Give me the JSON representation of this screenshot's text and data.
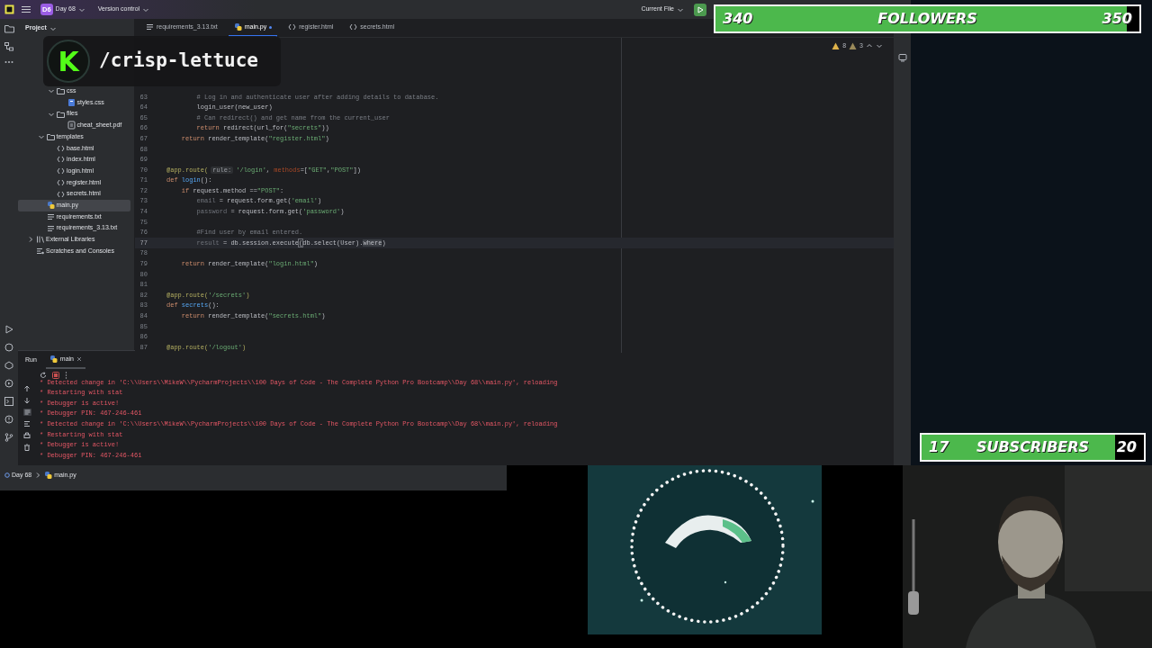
{
  "title_bar": {
    "project_initials": "D6",
    "project": "Day 68",
    "vcs": "Version control",
    "run_config": "Current File"
  },
  "project_panel": {
    "title": "Project",
    "tree": [
      {
        "children": [
          {
            "children": [
              {
                "label": "css",
                "kind": "folder",
                "expanded": true,
                "selected": false,
                "children": [
                  {
                    "label": "styles.css",
                    "kind": "css",
                    "selected": false
                  }
                ]
              },
              {
                "label": "files",
                "kind": "folder",
                "expanded": true,
                "selected": false,
                "children": [
                  {
                    "label": "cheat_sheet.pdf",
                    "kind": "pdf",
                    "selected": false
                  }
                ]
              }
            ]
          },
          {
            "label": "templates",
            "kind": "folder",
            "expanded": true,
            "selected": false,
            "children": [
              {
                "label": "base.html",
                "kind": "html",
                "selected": false
              },
              {
                "label": "index.html",
                "kind": "html",
                "selected": false
              },
              {
                "label": "login.html",
                "kind": "html",
                "selected": false
              },
              {
                "label": "register.html",
                "kind": "html",
                "selected": false
              },
              {
                "label": "secrets.html",
                "kind": "html",
                "selected": false
              }
            ]
          },
          {
            "label": "main.py",
            "kind": "python",
            "selected": true
          },
          {
            "label": "requirements.txt",
            "kind": "text",
            "selected": false
          },
          {
            "label": "requirements_3.13.txt",
            "kind": "text",
            "selected": false
          }
        ]
      },
      {
        "label": "External Libraries",
        "kind": "library",
        "expanded": false,
        "selected": false
      },
      {
        "label": "Scratches and Consoles",
        "kind": "scratches",
        "selected": false
      }
    ]
  },
  "editor_tabs": [
    {
      "label": "requirements_3.13.txt",
      "kind": "text",
      "selected": false,
      "modified": false
    },
    {
      "label": "main.py",
      "kind": "python",
      "selected": true,
      "modified": true
    },
    {
      "label": "register.html",
      "kind": "html",
      "selected": false,
      "modified": false
    },
    {
      "label": "secrets.html",
      "kind": "html",
      "selected": false,
      "modified": false
    }
  ],
  "inspections": {
    "warnings": "8",
    "weak_warnings": "3"
  },
  "editor": {
    "lines": [
      {
        "number": "63",
        "current": false,
        "segments": [
          {
            "text": "        # Log in and authenticate user after adding details to database.",
            "kind": "comment"
          }
        ]
      },
      {
        "number": "64",
        "current": false,
        "segments": [
          {
            "text": "        login_user(new_user)",
            "kind": "plain"
          }
        ]
      },
      {
        "number": "65",
        "current": false,
        "segments": [
          {
            "text": "        # Can redirect() and get name from the current_user",
            "kind": "comment"
          }
        ]
      },
      {
        "number": "66",
        "current": false,
        "segments": [
          {
            "text": "        return",
            "kind": "keyword"
          },
          {
            "text": " redirect(url_for(",
            "kind": "plain"
          },
          {
            "text": "\"secrets\"",
            "kind": "string"
          },
          {
            "text": "))",
            "kind": "plain"
          }
        ]
      },
      {
        "number": "67",
        "current": false,
        "segments": [
          {
            "text": "    return",
            "kind": "keyword"
          },
          {
            "text": " render_template(",
            "kind": "plain"
          },
          {
            "text": "\"register.html\"",
            "kind": "string"
          },
          {
            "text": ")",
            "kind": "plain"
          }
        ]
      },
      {
        "number": "68",
        "current": false
      },
      {
        "number": "69",
        "current": false
      },
      {
        "number": "70",
        "current": false,
        "segments": [
          {
            "text": "@app.route(",
            "kind": "decorator"
          },
          {
            "text": "rule:",
            "kind": "hint"
          },
          {
            "text": "'/login'",
            "kind": "string"
          },
          {
            "text": ", ",
            "kind": "plain"
          },
          {
            "text": "methods",
            "kind": "param"
          },
          {
            "text": "=[",
            "kind": "plain"
          },
          {
            "text": "\"GET\"",
            "kind": "string"
          },
          {
            "text": ",",
            "kind": "plain"
          },
          {
            "text": "\"POST\"",
            "kind": "string"
          },
          {
            "text": "])",
            "kind": "plain"
          }
        ]
      },
      {
        "number": "71",
        "current": false,
        "segments": [
          {
            "text": "def",
            "kind": "keyword"
          },
          {
            "text": " login",
            "kind": "function"
          },
          {
            "text": "():",
            "kind": "plain"
          }
        ]
      },
      {
        "number": "72",
        "current": false,
        "segments": [
          {
            "text": "    if",
            "kind": "keyword"
          },
          {
            "text": " request.method ==",
            "kind": "plain"
          },
          {
            "text": "\"POST\"",
            "kind": "string"
          },
          {
            "text": ":",
            "kind": "plain"
          }
        ]
      },
      {
        "number": "73",
        "current": false,
        "segments": [
          {
            "text": "        email",
            "kind": "unused"
          },
          {
            "text": " = request.form.get(",
            "kind": "plain"
          },
          {
            "text": "'email'",
            "kind": "string"
          },
          {
            "text": ")",
            "kind": "plain"
          }
        ]
      },
      {
        "number": "74",
        "current": false,
        "segments": [
          {
            "text": "        password",
            "kind": "unused"
          },
          {
            "text": " = request.form.get(",
            "kind": "plain"
          },
          {
            "text": "'password'",
            "kind": "string"
          },
          {
            "text": ")",
            "kind": "plain"
          }
        ]
      },
      {
        "number": "75",
        "current": false
      },
      {
        "number": "76",
        "current": false,
        "segments": [
          {
            "text": "        #Find user by email entered.",
            "kind": "comment"
          }
        ]
      },
      {
        "number": "77",
        "current": true,
        "segments": [
          {
            "text": "        result",
            "kind": "unused"
          },
          {
            "text": " = db.session.execute",
            "kind": "plain"
          },
          {
            "text": "(",
            "kind": "bracket"
          },
          {
            "text": "db.select(User).",
            "kind": "plain"
          },
          {
            "text": "where",
            "kind": "match"
          },
          {
            "text": ")",
            "kind": "plain"
          }
        ]
      },
      {
        "number": "78",
        "current": false
      },
      {
        "number": "79",
        "current": false,
        "segments": [
          {
            "text": "    return",
            "kind": "keyword"
          },
          {
            "text": " render_template(",
            "kind": "plain"
          },
          {
            "text": "\"login.html\"",
            "kind": "string"
          },
          {
            "text": ")",
            "kind": "plain"
          }
        ]
      },
      {
        "number": "80",
        "current": false
      },
      {
        "number": "81",
        "current": false
      },
      {
        "number": "82",
        "current": false,
        "segments": [
          {
            "text": "@app.route(",
            "kind": "decorator"
          },
          {
            "text": "'/secrets'",
            "kind": "string"
          },
          {
            "text": ")",
            "kind": "decorator"
          }
        ]
      },
      {
        "number": "83",
        "current": false,
        "segments": [
          {
            "text": "def",
            "kind": "keyword"
          },
          {
            "text": " secrets",
            "kind": "function"
          },
          {
            "text": "():",
            "kind": "plain"
          }
        ]
      },
      {
        "number": "84",
        "current": false,
        "segments": [
          {
            "text": "    return",
            "kind": "keyword"
          },
          {
            "text": " render_template(",
            "kind": "plain"
          },
          {
            "text": "\"secrets.html\"",
            "kind": "string"
          },
          {
            "text": ")",
            "kind": "plain"
          }
        ]
      },
      {
        "number": "85",
        "current": false
      },
      {
        "number": "86",
        "current": false
      },
      {
        "number": "87",
        "current": false,
        "segments": [
          {
            "text": "@app.route(",
            "kind": "decorator"
          },
          {
            "text": "'/logout'",
            "kind": "string"
          },
          {
            "text": ")",
            "kind": "decorator"
          }
        ]
      }
    ]
  },
  "run_panel": {
    "title": "Run",
    "tabs": [
      {
        "label": "main",
        "selected": true
      }
    ],
    "console": [
      "* Detected change in 'C:\\\\Users\\\\MikeW\\\\PycharmProjects\\\\100 Days of Code - The Complete Python Pro Bootcamp\\\\Day 68\\\\main.py', reloading",
      "* Restarting with stat",
      "* Debugger is active!",
      "* Debugger PIN: 467-246-461",
      "* Detected change in 'C:\\\\Users\\\\MikeW\\\\PycharmProjects\\\\100 Days of Code - The Complete Python Pro Bootcamp\\\\Day 68\\\\main.py', reloading",
      "* Restarting with stat",
      "* Debugger is active!",
      "* Debugger PIN: 467-246-461"
    ]
  },
  "status_bar": {
    "breadcrumbs": [
      "Day 68",
      "main.py"
    ]
  },
  "stream": {
    "channel": {
      "logo": "K",
      "name": "/crisp-lettuce"
    },
    "followers": {
      "current": "340",
      "label": "FOLLOWERS",
      "goal": "350",
      "level": 0.97
    },
    "subscribers": {
      "current": "17",
      "label": "SUBSCRIBERS",
      "goal": "20",
      "level": 0.87
    }
  }
}
